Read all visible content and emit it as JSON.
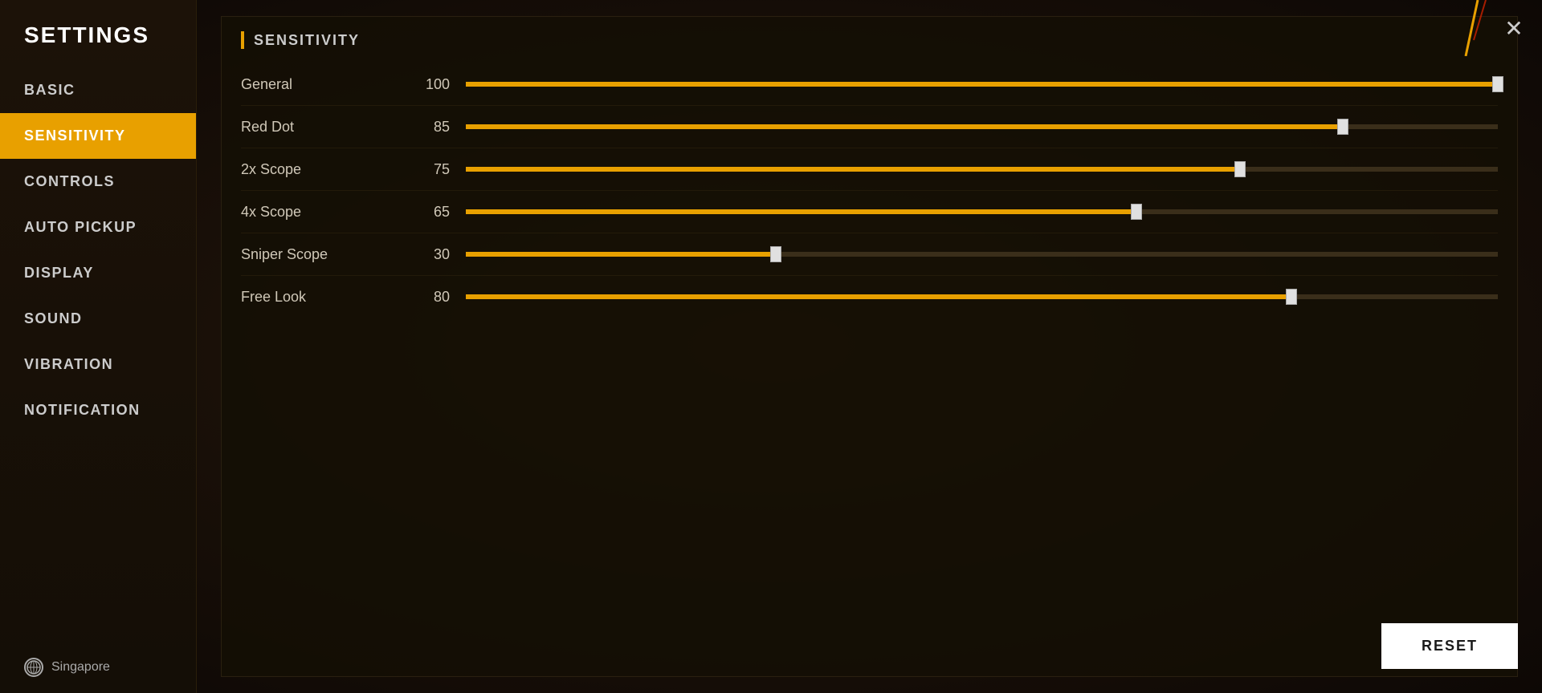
{
  "sidebar": {
    "title": "SETTINGS",
    "items": [
      {
        "id": "basic",
        "label": "BASIC",
        "active": false
      },
      {
        "id": "sensitivity",
        "label": "SENSITIVITY",
        "active": true
      },
      {
        "id": "controls",
        "label": "CONTROLS",
        "active": false
      },
      {
        "id": "auto-pickup",
        "label": "AUTO PICKUP",
        "active": false
      },
      {
        "id": "display",
        "label": "DISPLAY",
        "active": false
      },
      {
        "id": "sound",
        "label": "SOUND",
        "active": false
      },
      {
        "id": "vibration",
        "label": "VIBRATION",
        "active": false
      },
      {
        "id": "notification",
        "label": "NOTIFICATION",
        "active": false
      }
    ],
    "footer": {
      "region": "Singapore",
      "globe_icon": "globe-icon"
    }
  },
  "main": {
    "close_label": "✕",
    "section_title": "SENSITIVITY",
    "sliders": [
      {
        "label": "General",
        "value": 100,
        "percent": 100
      },
      {
        "label": "Red Dot",
        "value": 85,
        "percent": 85
      },
      {
        "label": "2x Scope",
        "value": 75,
        "percent": 75
      },
      {
        "label": "4x Scope",
        "value": 65,
        "percent": 65
      },
      {
        "label": "Sniper Scope",
        "value": 30,
        "percent": 30
      },
      {
        "label": "Free Look",
        "value": 80,
        "percent": 80
      }
    ],
    "reset_label": "RESET"
  }
}
